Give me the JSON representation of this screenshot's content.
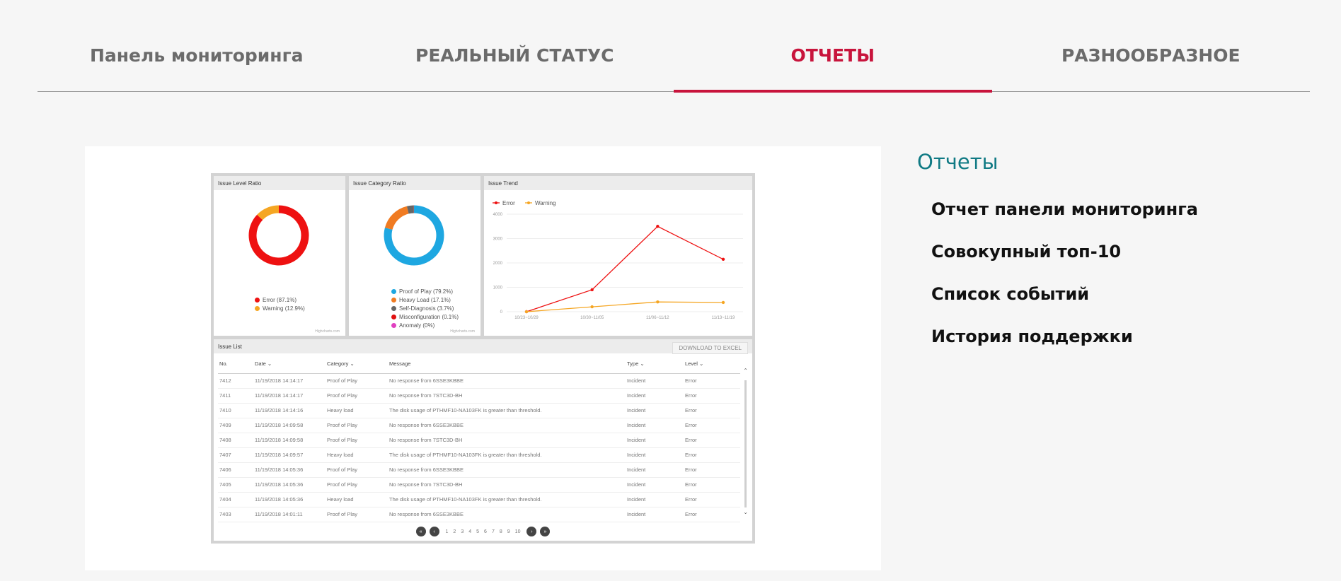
{
  "tabs": [
    {
      "label": "Панель мониторинга",
      "active": false
    },
    {
      "label": "РЕАЛЬНЫЙ СТАТУС",
      "active": false
    },
    {
      "label": "ОТЧЕТЫ",
      "active": true
    },
    {
      "label": "РАЗНООБРАЗНОЕ",
      "active": false
    }
  ],
  "sidebar": {
    "title": "Отчеты",
    "items": [
      {
        "label": "Отчет панели мониторинга"
      },
      {
        "label": "Совокупный топ-10"
      },
      {
        "label": "Список событий"
      },
      {
        "label": "История поддержки"
      }
    ]
  },
  "colors": {
    "accent": "#c8143c",
    "sidebar_title": "#107a84",
    "error": "#ee1111",
    "warning": "#f5a623",
    "proof": "#1ea7e1",
    "heavy": "#f07b22",
    "self_diag": "#666666",
    "misconfig": "#e01010",
    "anomaly": "#e040c0"
  },
  "dashboard": {
    "level_ratio": {
      "title": "Issue Level Ratio",
      "credit": "Highcharts.com",
      "legend": [
        {
          "label": "Error (87.1%)",
          "color": "#ee1111"
        },
        {
          "label": "Warning (12.9%)",
          "color": "#f5a623"
        }
      ]
    },
    "category_ratio": {
      "title": "Issue Category Ratio",
      "credit": "Highcharts.com",
      "legend": [
        {
          "label": "Proof of Play (79.2%)",
          "color": "#1ea7e1"
        },
        {
          "label": "Heavy Load (17.1%)",
          "color": "#f07b22"
        },
        {
          "label": "Self-Diagnosis (3.7%)",
          "color": "#666666"
        },
        {
          "label": "Misconfiguration (0.1%)",
          "color": "#e01010"
        },
        {
          "label": "Anomaly (0%)",
          "color": "#e040c0"
        }
      ]
    },
    "trend": {
      "title": "Issue Trend",
      "legend": [
        "Error",
        "Warning"
      ]
    },
    "issue_list": {
      "title": "Issue List",
      "download_label": "DOWNLOAD TO EXCEL",
      "columns": [
        "No.",
        "Date ⌄",
        "Category ⌄",
        "Message",
        "Type ⌄",
        "Level ⌄"
      ],
      "rows": [
        [
          "7412",
          "11/19/2018 14:14:17",
          "Proof of Play",
          "No response from 6SSE3KBBE",
          "Incident",
          "Error"
        ],
        [
          "7411",
          "11/19/2018 14:14:17",
          "Proof of Play",
          "No response from 7STC3D-BH",
          "Incident",
          "Error"
        ],
        [
          "7410",
          "11/19/2018 14:14:16",
          "Heavy load",
          "The disk usage of PTHMF10-NA103FK is greater than threshold.",
          "Incident",
          "Error"
        ],
        [
          "7409",
          "11/19/2018 14:09:58",
          "Proof of Play",
          "No response from 6SSE3KBBE",
          "Incident",
          "Error"
        ],
        [
          "7408",
          "11/19/2018 14:09:58",
          "Proof of Play",
          "No response from 7STC3D-BH",
          "Incident",
          "Error"
        ],
        [
          "7407",
          "11/19/2018 14:09:57",
          "Heavy load",
          "The disk usage of PTHMF10-NA103FK is greater than threshold.",
          "Incident",
          "Error"
        ],
        [
          "7406",
          "11/19/2018 14:05:36",
          "Proof of Play",
          "No response from 6SSE3KBBE",
          "Incident",
          "Error"
        ],
        [
          "7405",
          "11/19/2018 14:05:36",
          "Proof of Play",
          "No response from 7STC3D-BH",
          "Incident",
          "Error"
        ],
        [
          "7404",
          "11/19/2018 14:05:36",
          "Heavy load",
          "The disk usage of PTHMF10-NA103FK is greater than threshold.",
          "Incident",
          "Error"
        ],
        [
          "7403",
          "11/19/2018 14:01:11",
          "Proof of Play",
          "No response from 6SSE3KBBE",
          "Incident",
          "Error"
        ]
      ],
      "pages": [
        "1",
        "2",
        "3",
        "4",
        "5",
        "6",
        "7",
        "8",
        "9",
        "10"
      ]
    }
  },
  "chart_data": [
    {
      "type": "pie",
      "title": "Issue Level Ratio",
      "categories": [
        "Error",
        "Warning"
      ],
      "values": [
        87.1,
        12.9
      ]
    },
    {
      "type": "pie",
      "title": "Issue Category Ratio",
      "categories": [
        "Proof of Play",
        "Heavy Load",
        "Self-Diagnosis",
        "Misconfiguration",
        "Anomaly"
      ],
      "values": [
        79.2,
        17.1,
        3.7,
        0.1,
        0
      ]
    },
    {
      "type": "line",
      "title": "Issue Trend",
      "categories": [
        "10/23~10/29",
        "10/30~11/05",
        "11/06~11/12",
        "11/13~11/19"
      ],
      "series": [
        {
          "name": "Error",
          "values": [
            0,
            900,
            3500,
            2150
          ]
        },
        {
          "name": "Warning",
          "values": [
            0,
            200,
            400,
            380
          ]
        }
      ],
      "ylim": [
        0,
        4000
      ],
      "yticks": [
        "0",
        "1000",
        "2000",
        "3000",
        "4000"
      ],
      "legend": "top-left",
      "grid": true
    }
  ]
}
